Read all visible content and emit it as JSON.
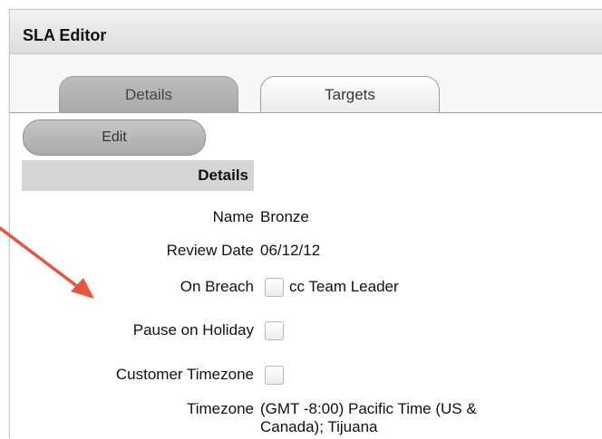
{
  "window": {
    "title": "SLA Editor"
  },
  "tabs": [
    {
      "label": "Details",
      "active": true
    },
    {
      "label": "Targets",
      "active": false
    }
  ],
  "toolbar": {
    "edit_label": "Edit"
  },
  "details": {
    "section_title": "Details",
    "fields": {
      "name": {
        "label": "Name",
        "value": "Bronze"
      },
      "review_date": {
        "label": "Review Date",
        "value": "06/12/12"
      },
      "on_breach": {
        "label": "On Breach",
        "option_label": "cc Team Leader",
        "checked": false
      },
      "pause_on_holiday": {
        "label": "Pause on Holiday",
        "checked": false
      },
      "customer_timezone": {
        "label": "Customer Timezone",
        "checked": false
      },
      "timezone": {
        "label": "Timezone",
        "value_line1": "(GMT -8:00) Pacific Time (US &",
        "value_line2": "Canada); Tijuana"
      }
    }
  },
  "colors": {
    "annotation_arrow": "#e8553f",
    "tab_active": "#b3b3b3",
    "section_header": "#d5d5d5"
  }
}
